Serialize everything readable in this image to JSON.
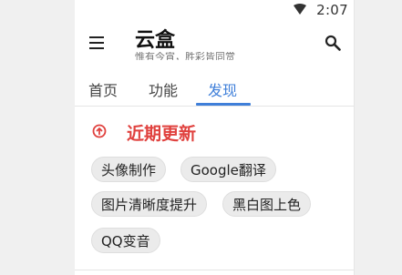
{
  "status": {
    "time": "2:07",
    "wifi_icon": "wifi-icon"
  },
  "appbar": {
    "menu_icon": "menu-icon",
    "title": "云盒",
    "subtitle": "惟有今宵，胜彩皆同赏",
    "search_icon": "search-icon"
  },
  "tabs": [
    {
      "label": "首页",
      "active": false
    },
    {
      "label": "功能",
      "active": false
    },
    {
      "label": "发现",
      "active": true
    }
  ],
  "section": {
    "icon": "update-icon",
    "title": "近期更新",
    "accent_color": "#e0413e"
  },
  "chips": [
    {
      "label": "头像制作"
    },
    {
      "label": "Google翻译"
    },
    {
      "label": "图片清晰度提升"
    },
    {
      "label": "黑白图上色"
    },
    {
      "label": "QQ变音"
    }
  ],
  "colors": {
    "tab_active": "#3f7fd9",
    "chip_bg": "#ebebeb"
  }
}
